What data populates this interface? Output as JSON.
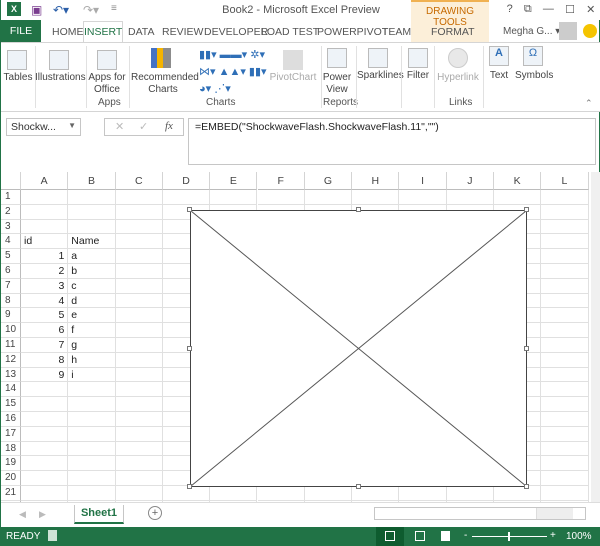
{
  "title": "Book2 - Microsoft Excel Preview",
  "contextual_tab": "DRAWING TOOLS",
  "window_buttons": [
    "?",
    "⧉",
    "—",
    "☐",
    "✕"
  ],
  "tabs": {
    "file": "FILE",
    "home": "HOME",
    "insert": "INSERT",
    "data": "DATA",
    "review": "REVIEW",
    "developer": "DEVELOPER",
    "load_test": "LOAD TEST",
    "powerpivot": "POWERPIVOT",
    "team": "TEAM",
    "format": "FORMAT"
  },
  "user": "Megha G... ▾",
  "ribbon": {
    "tables": "Tables",
    "illustrations": "Illustrations",
    "apps_for_office": "Apps for Office",
    "recommended_charts": "Recommended Charts",
    "pivotchart": "PivotChart",
    "power_view": "Power View",
    "sparklines": "Sparklines",
    "filter": "Filter",
    "hyperlink": "Hyperlink",
    "text": "Text",
    "symbols": "Symbols",
    "groups": {
      "apps": "Apps",
      "charts": "Charts",
      "reports": "Reports",
      "links": "Links"
    }
  },
  "name_box": "Shockw...",
  "formula": "=EMBED(\"ShockwaveFlash.ShockwaveFlash.11\",\"\")",
  "columns": [
    "A",
    "B",
    "C",
    "D",
    "E",
    "F",
    "G",
    "H",
    "I",
    "J",
    "K",
    "L"
  ],
  "row_count": 22,
  "cells": [
    {
      "row": 4,
      "col": 0,
      "v": "id",
      "align": "left"
    },
    {
      "row": 4,
      "col": 1,
      "v": "Name",
      "align": "left"
    },
    {
      "row": 5,
      "col": 0,
      "v": "1",
      "align": "right"
    },
    {
      "row": 5,
      "col": 1,
      "v": "a",
      "align": "left"
    },
    {
      "row": 6,
      "col": 0,
      "v": "2",
      "align": "right"
    },
    {
      "row": 6,
      "col": 1,
      "v": "b",
      "align": "left"
    },
    {
      "row": 7,
      "col": 0,
      "v": "3",
      "align": "right"
    },
    {
      "row": 7,
      "col": 1,
      "v": "c",
      "align": "left"
    },
    {
      "row": 8,
      "col": 0,
      "v": "4",
      "align": "right"
    },
    {
      "row": 8,
      "col": 1,
      "v": "d",
      "align": "left"
    },
    {
      "row": 9,
      "col": 0,
      "v": "5",
      "align": "right"
    },
    {
      "row": 9,
      "col": 1,
      "v": "e",
      "align": "left"
    },
    {
      "row": 10,
      "col": 0,
      "v": "6",
      "align": "right"
    },
    {
      "row": 10,
      "col": 1,
      "v": "f",
      "align": "left"
    },
    {
      "row": 11,
      "col": 0,
      "v": "7",
      "align": "right"
    },
    {
      "row": 11,
      "col": 1,
      "v": "g",
      "align": "left"
    },
    {
      "row": 12,
      "col": 0,
      "v": "8",
      "align": "right"
    },
    {
      "row": 12,
      "col": 1,
      "v": "h",
      "align": "left"
    },
    {
      "row": 13,
      "col": 0,
      "v": "9",
      "align": "right"
    },
    {
      "row": 13,
      "col": 1,
      "v": "i",
      "align": "left"
    }
  ],
  "sheet_tab": "Sheet1",
  "status": {
    "mode": "READY",
    "zoom": "100%",
    "zoom_minus": "-",
    "zoom_plus": "+"
  }
}
